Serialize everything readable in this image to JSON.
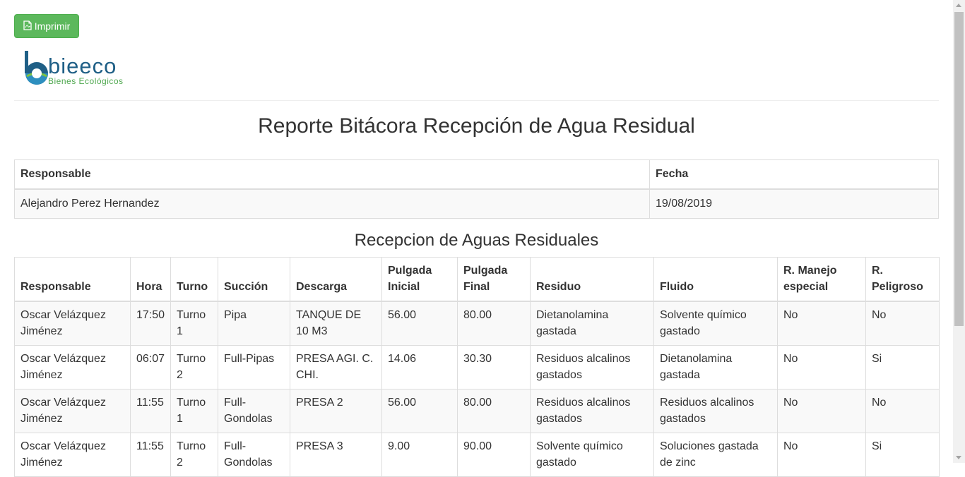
{
  "toolbar": {
    "print_label": "Imprimir",
    "print_icon": "file-pdf-icon"
  },
  "logo": {
    "brand": "bieeco",
    "tagline": "Bienes Ecológicos"
  },
  "page_title": "Reporte Bitácora Recepción de Agua Residual",
  "meta": {
    "headers": [
      "Responsable",
      "Fecha"
    ],
    "values": [
      "Alejandro Perez Hernandez",
      "19/08/2019"
    ]
  },
  "section_title": "Recepcion de Aguas Residuales",
  "table": {
    "headers": [
      "Responsable",
      "Hora",
      "Turno",
      "Succión",
      "Descarga",
      "Pulgada Inicial",
      "Pulgada Final",
      "Residuo",
      "Fluido",
      "R. Manejo especial",
      "R. Peligroso"
    ],
    "rows": [
      [
        "Oscar Velázquez Jiménez",
        "17:50",
        "Turno 1",
        "Pipa",
        "TANQUE DE 10 M3",
        "56.00",
        "80.00",
        "Dietanolamina gastada",
        "Solvente químico gastado",
        "No",
        "No"
      ],
      [
        "Oscar Velázquez Jiménez",
        "06:07",
        "Turno 2",
        "Full-Pipas",
        "PRESA AGI. C. CHI.",
        "14.06",
        "30.30",
        "Residuos alcalinos gastados",
        "Dietanolamina gastada",
        "No",
        "Si"
      ],
      [
        "Oscar Velázquez Jiménez",
        "11:55",
        "Turno 1",
        "Full-Gondolas",
        "PRESA 2",
        "56.00",
        "80.00",
        "Residuos alcalinos gastados",
        "Residuos alcalinos gastados",
        "No",
        "No"
      ],
      [
        "Oscar Velázquez Jiménez",
        "11:55",
        "Turno 2",
        "Full-Gondolas",
        "PRESA 3",
        "9.00",
        "90.00",
        "Solvente químico gastado",
        "Soluciones gastada de zinc",
        "No",
        "Si"
      ]
    ]
  },
  "colors": {
    "print_button": "#5cb85c",
    "logo_blue": "#1f5f86",
    "logo_green": "#4fa84f",
    "border": "#dddddd",
    "stripe": "#f9f9f9"
  }
}
